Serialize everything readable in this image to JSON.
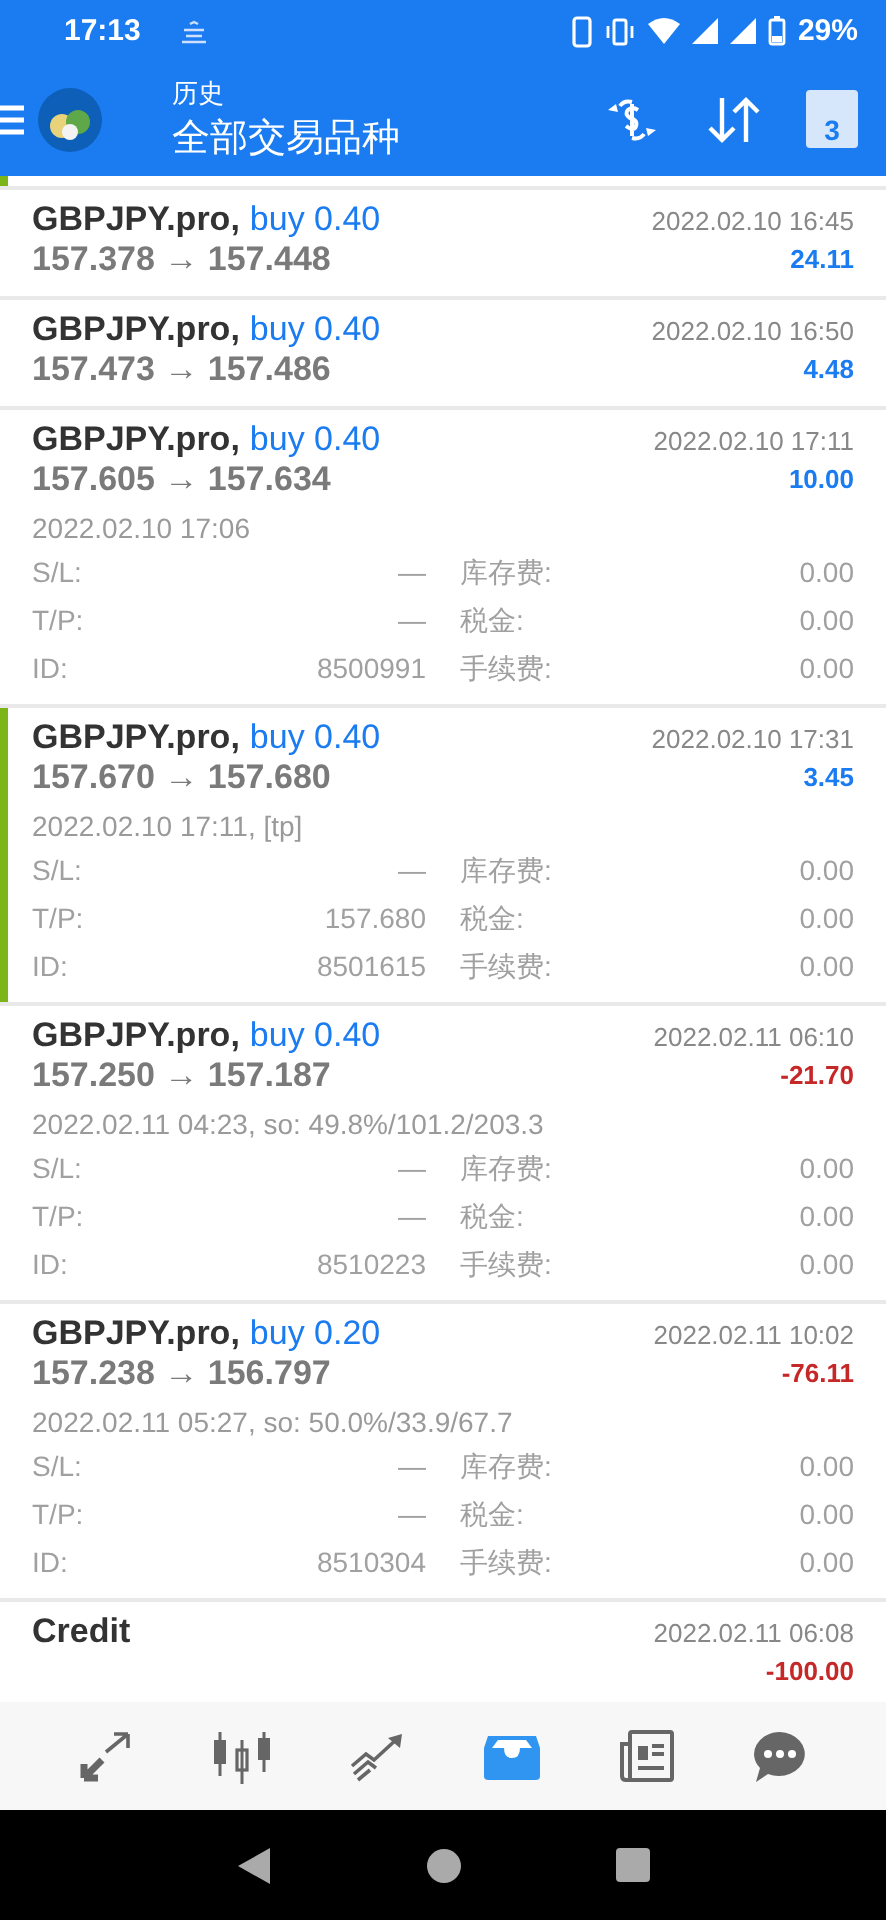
{
  "status_bar": {
    "time": "17:13",
    "battery": "29%"
  },
  "header": {
    "subtitle": "历史",
    "title": "全部交易品种"
  },
  "calendar_day": "3",
  "rows": [
    {
      "kind": "trade",
      "symbol": "GBPJPY.pro,",
      "side": "buy 0.40",
      "prices": "157.378 → 157.448",
      "time": "2022.02.10 16:45",
      "profit": "24.11",
      "loss": false,
      "selected": false,
      "expanded": false
    },
    {
      "kind": "trade",
      "symbol": "GBPJPY.pro,",
      "side": "buy 0.40",
      "prices": "157.473 → 157.486",
      "time": "2022.02.10 16:50",
      "profit": "4.48",
      "loss": false,
      "selected": false,
      "expanded": false
    },
    {
      "kind": "trade",
      "symbol": "GBPJPY.pro,",
      "side": "buy 0.40",
      "prices": "157.605 → 157.634",
      "time": "2022.02.10 17:11",
      "profit": "10.00",
      "loss": false,
      "selected": false,
      "expanded": true,
      "open_info": "2022.02.10 17:06",
      "details": [
        [
          "S/L:",
          "—",
          "库存费:",
          "0.00"
        ],
        [
          "T/P:",
          "—",
          "税金:",
          "0.00"
        ],
        [
          "ID:",
          "8500991",
          "手续费:",
          "0.00"
        ]
      ]
    },
    {
      "kind": "trade",
      "symbol": "GBPJPY.pro,",
      "side": "buy 0.40",
      "prices": "157.670 → 157.680",
      "time": "2022.02.10 17:31",
      "profit": "3.45",
      "loss": false,
      "selected": true,
      "expanded": true,
      "open_info": "2022.02.10 17:11, [tp]",
      "details": [
        [
          "S/L:",
          "—",
          "库存费:",
          "0.00"
        ],
        [
          "T/P:",
          "157.680",
          "税金:",
          "0.00"
        ],
        [
          "ID:",
          "8501615",
          "手续费:",
          "0.00"
        ]
      ]
    },
    {
      "kind": "trade",
      "symbol": "GBPJPY.pro,",
      "side": "buy 0.40",
      "prices": "157.250 → 157.187",
      "time": "2022.02.11 06:10",
      "profit": "-21.70",
      "loss": true,
      "selected": false,
      "expanded": true,
      "open_info": "2022.02.11 04:23, so: 49.8%/101.2/203.3",
      "details": [
        [
          "S/L:",
          "—",
          "库存费:",
          "0.00"
        ],
        [
          "T/P:",
          "—",
          "税金:",
          "0.00"
        ],
        [
          "ID:",
          "8510223",
          "手续费:",
          "0.00"
        ]
      ]
    },
    {
      "kind": "trade",
      "symbol": "GBPJPY.pro,",
      "side": "buy 0.20",
      "prices": "157.238 → 156.797",
      "time": "2022.02.11 10:02",
      "profit": "-76.11",
      "loss": true,
      "selected": false,
      "expanded": true,
      "open_info": "2022.02.11 05:27, so: 50.0%/33.9/67.7",
      "details": [
        [
          "S/L:",
          "—",
          "库存费:",
          "0.00"
        ],
        [
          "T/P:",
          "—",
          "税金:",
          "0.00"
        ],
        [
          "ID:",
          "8510304",
          "手续费:",
          "0.00"
        ]
      ]
    },
    {
      "kind": "credit",
      "symbol": "Credit",
      "time": "2022.02.11 06:08",
      "profit": "-100.00",
      "loss": true,
      "selected": false,
      "expanded": false
    }
  ],
  "nav": [
    {
      "kind": "arrows",
      "selected": false
    },
    {
      "kind": "candles",
      "selected": false
    },
    {
      "kind": "trend",
      "selected": false
    },
    {
      "kind": "inbox",
      "selected": true
    },
    {
      "kind": "news",
      "selected": false
    },
    {
      "kind": "chat",
      "selected": false
    }
  ]
}
